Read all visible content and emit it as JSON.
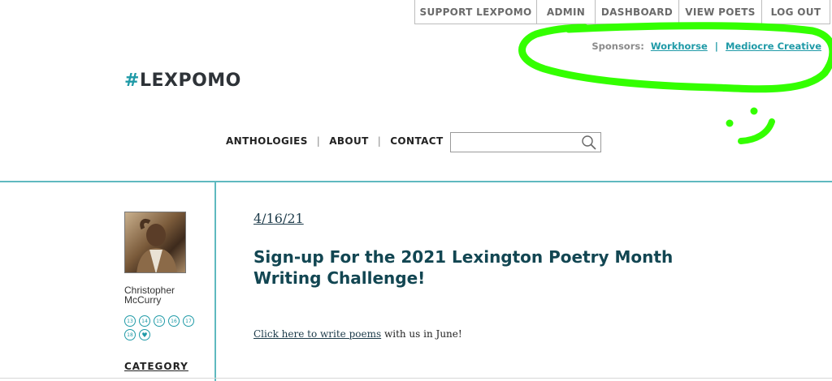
{
  "topbar": {
    "items": [
      "SUPPORT LEXPOMO",
      "ADMIN",
      "DASHBOARD",
      "VIEW POETS",
      "LOG OUT"
    ]
  },
  "sponsors": {
    "label": "Sponsors:",
    "links": [
      "Workhorse",
      "Mediocre Creative"
    ],
    "separator": "|"
  },
  "logo": {
    "hash": "#",
    "text": "LEXPOMO"
  },
  "mainnav": {
    "items": [
      "ANTHOLOGIES",
      "ABOUT",
      "CONTACT"
    ],
    "divider": "|"
  },
  "search": {
    "value": "",
    "placeholder": "",
    "icon": "search-icon"
  },
  "sidebar": {
    "username_line1": "Christopher",
    "username_line2": "McCurry",
    "badges": [
      "13",
      "14",
      "15",
      "16",
      "17",
      "18",
      "♥"
    ],
    "category_label": "CATEGORY"
  },
  "post": {
    "date": "4/16/21",
    "title": "Sign-up For the 2021 Lexington Poetry Month Writing Challenge!",
    "link_text": "Click here to write poems",
    "body_rest": " with us in June!"
  },
  "colors": {
    "accent": "#1f9aa7",
    "title": "#124652",
    "highlight": "#33ff00"
  }
}
